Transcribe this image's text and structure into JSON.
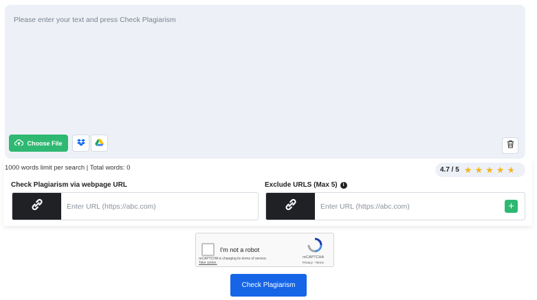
{
  "editor": {
    "placeholder": "Please enter your text and press Check Plagiarism",
    "choose_file_label": "Choose File",
    "icons": {
      "upload": "cloud-upload-icon",
      "dropbox": "dropbox-icon",
      "drive": "google-drive-icon",
      "trash": "trash-icon"
    }
  },
  "status": {
    "limit_text": "1000 words limit per search | Total words: 0"
  },
  "rating": {
    "value_text": "4.7 / 5",
    "value": 4.7,
    "max": 5
  },
  "url_check": {
    "label": "Check Plagiarism via webpage URL",
    "placeholder": "Enter URL (https://abc.com)",
    "icon": "link-icon"
  },
  "exclude_urls": {
    "label": "Exclude URLS (Max 5)",
    "info_icon": "info-icon",
    "placeholder": "Enter URL (https://abc.com)",
    "add_label": "+",
    "icon": "link-icon"
  },
  "captcha": {
    "label": "I'm not a robot",
    "note_line1": "reCAPTCHA is changing its terms of service.",
    "note_link": "Take action.",
    "brand": "reCAPTCHA",
    "links": "Privacy - Terms"
  },
  "submit": {
    "label": "Check Plagiarism"
  },
  "colors": {
    "accent_green": "#2eb872",
    "primary_blue": "#1565e6",
    "editor_bg": "#edf1f7",
    "star": "#f5b31f"
  }
}
